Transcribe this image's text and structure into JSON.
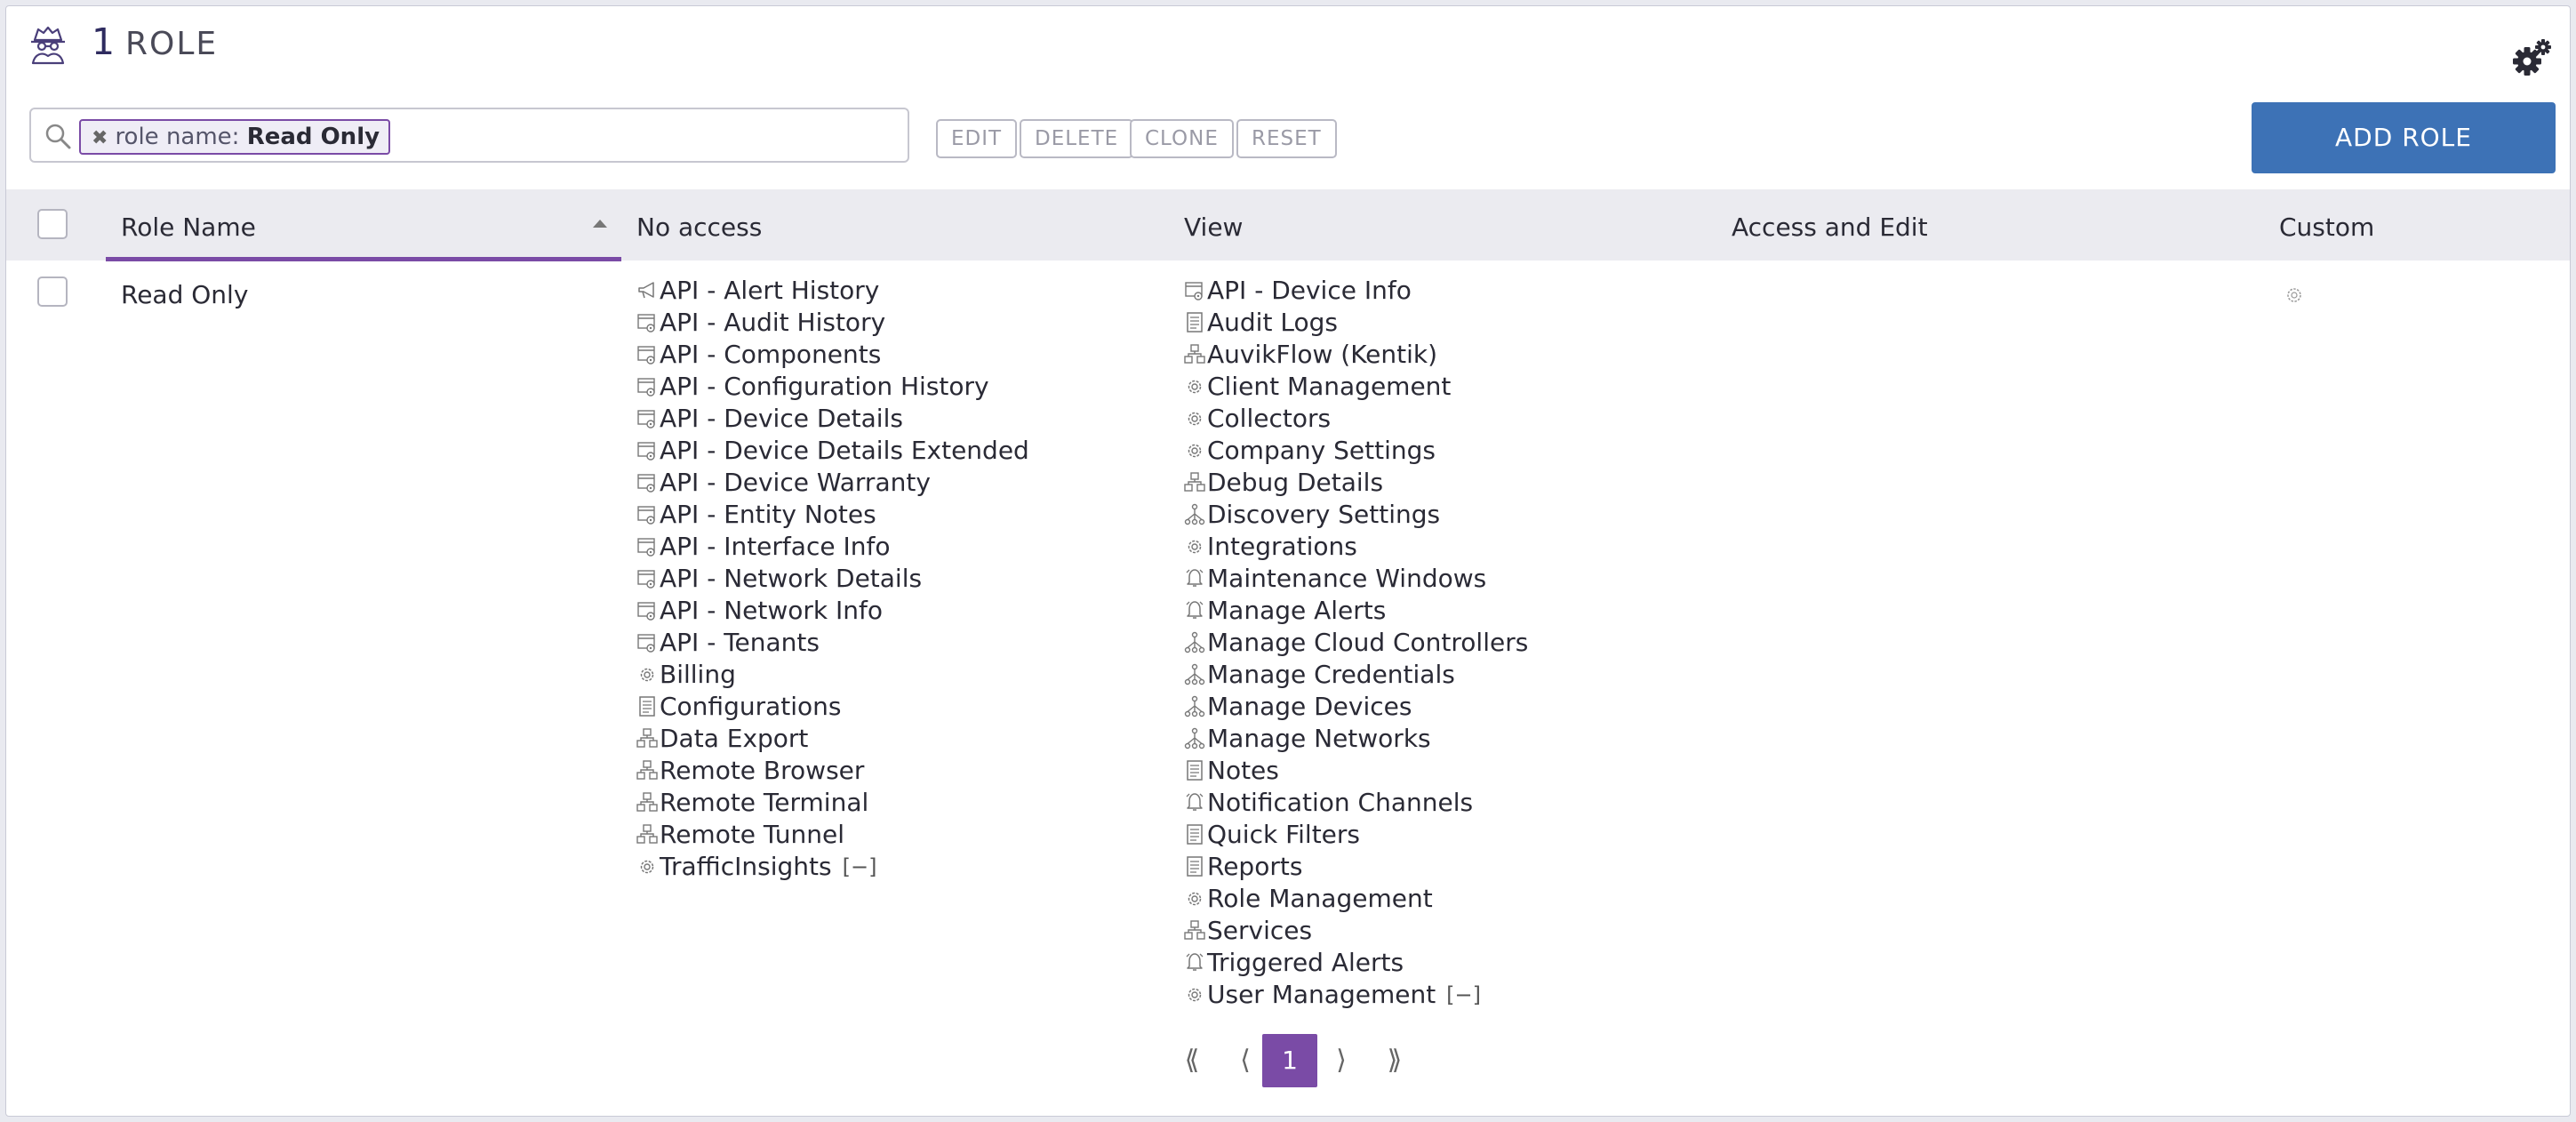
{
  "header": {
    "count": "1",
    "title": "ROLE"
  },
  "search": {
    "chip_key": "role name:",
    "chip_value": "Read Only"
  },
  "toolbar": {
    "edit": "EDIT",
    "delete": "DELETE",
    "clone": "CLONE",
    "reset": "RESET",
    "add_role": "ADD ROLE"
  },
  "table": {
    "columns": {
      "role_name": "Role Name",
      "no_access": "No access",
      "view": "View",
      "access_edit": "Access and Edit",
      "custom": "Custom"
    },
    "sort": "Role Name ascending",
    "row": {
      "role_name": "Read Only",
      "no_access": [
        {
          "label": "API - Alert History",
          "icon": "megaphone-icon"
        },
        {
          "label": "API - Audit History",
          "icon": "api-window-icon"
        },
        {
          "label": "API - Components",
          "icon": "api-window-icon"
        },
        {
          "label": "API - Configuration History",
          "icon": "api-window-icon"
        },
        {
          "label": "API - Device Details",
          "icon": "api-window-icon"
        },
        {
          "label": "API - Device Details Extended",
          "icon": "api-window-icon"
        },
        {
          "label": "API - Device Warranty",
          "icon": "api-window-icon"
        },
        {
          "label": "API - Entity Notes",
          "icon": "api-window-icon"
        },
        {
          "label": "API - Interface Info",
          "icon": "api-window-icon"
        },
        {
          "label": "API - Network Details",
          "icon": "api-window-icon"
        },
        {
          "label": "API - Network Info",
          "icon": "api-window-icon"
        },
        {
          "label": "API - Tenants",
          "icon": "api-window-icon"
        },
        {
          "label": "Billing",
          "icon": "gear-icon"
        },
        {
          "label": "Configurations",
          "icon": "document-icon"
        },
        {
          "label": "Data Export",
          "icon": "network-boxes-icon"
        },
        {
          "label": "Remote Browser",
          "icon": "network-boxes-icon"
        },
        {
          "label": "Remote Terminal",
          "icon": "network-boxes-icon"
        },
        {
          "label": "Remote Tunnel",
          "icon": "network-boxes-icon"
        },
        {
          "label": "TrafficInsights",
          "icon": "gear-icon"
        }
      ],
      "view": [
        {
          "label": "API - Device Info",
          "icon": "api-window-icon"
        },
        {
          "label": "Audit Logs",
          "icon": "document-icon"
        },
        {
          "label": "AuvikFlow (Kentik)",
          "icon": "network-boxes-icon"
        },
        {
          "label": "Client Management",
          "icon": "gear-icon"
        },
        {
          "label": "Collectors",
          "icon": "gear-icon"
        },
        {
          "label": "Company Settings",
          "icon": "gear-icon"
        },
        {
          "label": "Debug Details",
          "icon": "network-boxes-icon"
        },
        {
          "label": "Discovery Settings",
          "icon": "topology-icon"
        },
        {
          "label": "Integrations",
          "icon": "gear-icon"
        },
        {
          "label": "Maintenance Windows",
          "icon": "bell-icon"
        },
        {
          "label": "Manage Alerts",
          "icon": "bell-icon"
        },
        {
          "label": "Manage Cloud Controllers",
          "icon": "topology-icon"
        },
        {
          "label": "Manage Credentials",
          "icon": "topology-icon"
        },
        {
          "label": "Manage Devices",
          "icon": "topology-icon"
        },
        {
          "label": "Manage Networks",
          "icon": "topology-icon"
        },
        {
          "label": "Notes",
          "icon": "document-icon"
        },
        {
          "label": "Notification Channels",
          "icon": "bell-icon"
        },
        {
          "label": "Quick Filters",
          "icon": "document-icon"
        },
        {
          "label": "Reports",
          "icon": "document-icon"
        },
        {
          "label": "Role Management",
          "icon": "gear-icon"
        },
        {
          "label": "Services",
          "icon": "network-boxes-icon"
        },
        {
          "label": "Triggered Alerts",
          "icon": "bell-icon"
        },
        {
          "label": "User Management",
          "icon": "gear-icon"
        }
      ],
      "collapse_label": "[−]"
    }
  },
  "pagination": {
    "first": "⟪",
    "prev": "⟨",
    "current": "1",
    "next": "⟩",
    "last": "⟫"
  },
  "colors": {
    "accent": "#7a4ba6",
    "primary_button": "#3d72b6",
    "header_bg": "#ebebf0"
  }
}
